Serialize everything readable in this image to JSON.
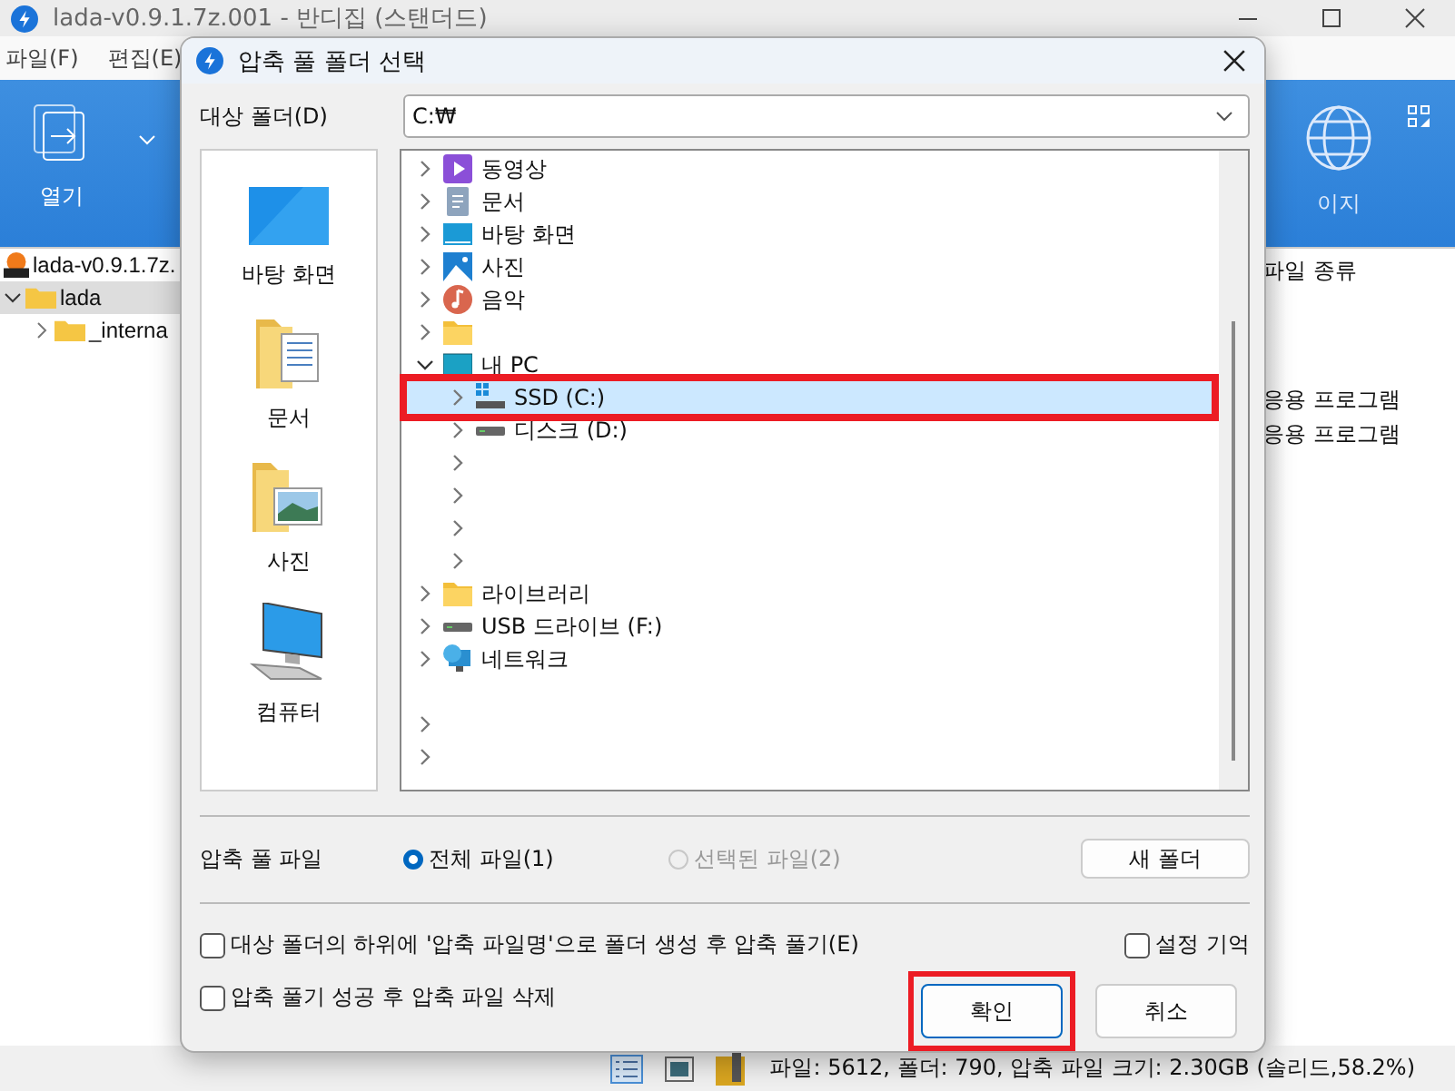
{
  "app": {
    "title": "lada-v0.9.1.7z.001 - 반디집 (스탠더드)",
    "menu": [
      "파일(F)",
      "편집(E)"
    ],
    "ribbon": [
      {
        "kind": "open",
        "label": "열기"
      },
      {
        "kind": "web",
        "label": "이지"
      }
    ],
    "tree": [
      {
        "kind": "archive",
        "label": "lada-v0.9.1.7z.",
        "selected": false
      },
      {
        "kind": "folder",
        "label": "lada",
        "expanded": true,
        "selected": true,
        "children": [
          {
            "kind": "folder",
            "label": "_interna",
            "expanded": false,
            "selected": false
          }
        ]
      }
    ],
    "file_types": {
      "header": "파일 종류",
      "rows": [
        "응용 프로그램",
        "응용 프로그램"
      ]
    },
    "status_bar": "파일: 5612, 폴더: 790, 압축 파일 크기: 2.30GB (솔리드,58.2%)"
  },
  "dialog": {
    "title": "압축 풀 폴더 선택",
    "target_label": "대상 폴더(D)",
    "target_value": "C:₩",
    "places": [
      {
        "kind": "desktop",
        "label": "바탕 화면"
      },
      {
        "kind": "docs",
        "label": "문서"
      },
      {
        "kind": "photos",
        "label": "사진"
      },
      {
        "kind": "computer",
        "label": "컴퓨터"
      }
    ],
    "folders": [
      {
        "kind": "video",
        "label": "동영상",
        "expanded": false,
        "selected": false,
        "highlighted": false
      },
      {
        "kind": "doc",
        "label": "문서",
        "expanded": false,
        "selected": false,
        "highlighted": false
      },
      {
        "kind": "desktop",
        "label": "바탕 화면",
        "expanded": false,
        "selected": false,
        "highlighted": false
      },
      {
        "kind": "photo",
        "label": "사진",
        "expanded": false,
        "selected": false,
        "highlighted": false
      },
      {
        "kind": "music",
        "label": "음악",
        "expanded": false,
        "selected": false,
        "highlighted": false
      },
      {
        "kind": "folder",
        "expanded": false,
        "selected": false,
        "highlighted": false
      },
      {
        "kind": "pc",
        "label": "내 PC",
        "expanded": true,
        "selected": false,
        "highlighted": false,
        "children": [
          {
            "kind": "ssd",
            "label": "SSD (C:)",
            "expanded": false,
            "selected": true,
            "highlighted": true
          },
          {
            "kind": "drive",
            "label": "디스크 (D:)",
            "expanded": false,
            "selected": false,
            "highlighted": false
          },
          {
            "kind": "empty",
            "expanded": false,
            "selected": false,
            "highlighted": false
          },
          {
            "kind": "empty",
            "expanded": false,
            "selected": false,
            "highlighted": false
          },
          {
            "kind": "empty",
            "expanded": false,
            "selected": false,
            "highlighted": false
          },
          {
            "kind": "empty",
            "expanded": false,
            "selected": false,
            "highlighted": false
          }
        ]
      },
      {
        "kind": "library",
        "label": "라이브러리",
        "expanded": false,
        "selected": false,
        "highlighted": false
      },
      {
        "kind": "usb",
        "label": "USB 드라이브 (F:)",
        "expanded": false,
        "selected": false,
        "highlighted": false
      },
      {
        "kind": "network",
        "label": "네트워크",
        "expanded": false,
        "selected": false,
        "highlighted": false
      },
      {
        "kind": "gap",
        "selected": false,
        "highlighted": false
      },
      {
        "kind": "empty",
        "expanded": false,
        "selected": false,
        "highlighted": false
      },
      {
        "kind": "empty",
        "expanded": false,
        "selected": false,
        "highlighted": false
      }
    ],
    "scope_label": "압축 풀 파일",
    "scope_options": [
      {
        "label": "전체 파일(1)",
        "selected": true,
        "disabled": false
      },
      {
        "label": "선택된 파일(2)",
        "selected": false,
        "disabled": true
      }
    ],
    "new_folder": "새 폴더",
    "options": [
      {
        "label": "대상 폴더의 하위에 '압축 파일명'으로 폴더 생성 후 압축 풀기(E)",
        "checked": false
      },
      {
        "label": "압축 풀기 성공 후 압축 파일 삭제",
        "checked": false
      }
    ],
    "remember": {
      "label": "설정 기억",
      "checked": false
    },
    "buttons": [
      {
        "label": "확인",
        "default": true,
        "highlighted": true
      },
      {
        "label": "취소",
        "default": false,
        "highlighted": false
      }
    ]
  }
}
